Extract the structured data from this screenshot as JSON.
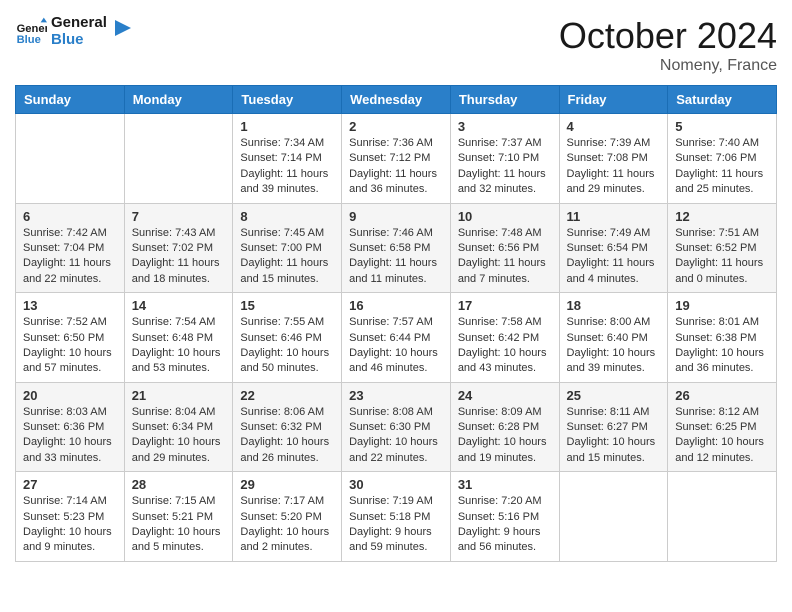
{
  "header": {
    "logo_general": "General",
    "logo_blue": "Blue",
    "month_title": "October 2024",
    "location": "Nomeny, France"
  },
  "days_of_week": [
    "Sunday",
    "Monday",
    "Tuesday",
    "Wednesday",
    "Thursday",
    "Friday",
    "Saturday"
  ],
  "weeks": [
    [
      {
        "day": "",
        "sunrise": "",
        "sunset": "",
        "daylight": ""
      },
      {
        "day": "",
        "sunrise": "",
        "sunset": "",
        "daylight": ""
      },
      {
        "day": "1",
        "sunrise": "Sunrise: 7:34 AM",
        "sunset": "Sunset: 7:14 PM",
        "daylight": "Daylight: 11 hours and 39 minutes."
      },
      {
        "day": "2",
        "sunrise": "Sunrise: 7:36 AM",
        "sunset": "Sunset: 7:12 PM",
        "daylight": "Daylight: 11 hours and 36 minutes."
      },
      {
        "day": "3",
        "sunrise": "Sunrise: 7:37 AM",
        "sunset": "Sunset: 7:10 PM",
        "daylight": "Daylight: 11 hours and 32 minutes."
      },
      {
        "day": "4",
        "sunrise": "Sunrise: 7:39 AM",
        "sunset": "Sunset: 7:08 PM",
        "daylight": "Daylight: 11 hours and 29 minutes."
      },
      {
        "day": "5",
        "sunrise": "Sunrise: 7:40 AM",
        "sunset": "Sunset: 7:06 PM",
        "daylight": "Daylight: 11 hours and 25 minutes."
      }
    ],
    [
      {
        "day": "6",
        "sunrise": "Sunrise: 7:42 AM",
        "sunset": "Sunset: 7:04 PM",
        "daylight": "Daylight: 11 hours and 22 minutes."
      },
      {
        "day": "7",
        "sunrise": "Sunrise: 7:43 AM",
        "sunset": "Sunset: 7:02 PM",
        "daylight": "Daylight: 11 hours and 18 minutes."
      },
      {
        "day": "8",
        "sunrise": "Sunrise: 7:45 AM",
        "sunset": "Sunset: 7:00 PM",
        "daylight": "Daylight: 11 hours and 15 minutes."
      },
      {
        "day": "9",
        "sunrise": "Sunrise: 7:46 AM",
        "sunset": "Sunset: 6:58 PM",
        "daylight": "Daylight: 11 hours and 11 minutes."
      },
      {
        "day": "10",
        "sunrise": "Sunrise: 7:48 AM",
        "sunset": "Sunset: 6:56 PM",
        "daylight": "Daylight: 11 hours and 7 minutes."
      },
      {
        "day": "11",
        "sunrise": "Sunrise: 7:49 AM",
        "sunset": "Sunset: 6:54 PM",
        "daylight": "Daylight: 11 hours and 4 minutes."
      },
      {
        "day": "12",
        "sunrise": "Sunrise: 7:51 AM",
        "sunset": "Sunset: 6:52 PM",
        "daylight": "Daylight: 11 hours and 0 minutes."
      }
    ],
    [
      {
        "day": "13",
        "sunrise": "Sunrise: 7:52 AM",
        "sunset": "Sunset: 6:50 PM",
        "daylight": "Daylight: 10 hours and 57 minutes."
      },
      {
        "day": "14",
        "sunrise": "Sunrise: 7:54 AM",
        "sunset": "Sunset: 6:48 PM",
        "daylight": "Daylight: 10 hours and 53 minutes."
      },
      {
        "day": "15",
        "sunrise": "Sunrise: 7:55 AM",
        "sunset": "Sunset: 6:46 PM",
        "daylight": "Daylight: 10 hours and 50 minutes."
      },
      {
        "day": "16",
        "sunrise": "Sunrise: 7:57 AM",
        "sunset": "Sunset: 6:44 PM",
        "daylight": "Daylight: 10 hours and 46 minutes."
      },
      {
        "day": "17",
        "sunrise": "Sunrise: 7:58 AM",
        "sunset": "Sunset: 6:42 PM",
        "daylight": "Daylight: 10 hours and 43 minutes."
      },
      {
        "day": "18",
        "sunrise": "Sunrise: 8:00 AM",
        "sunset": "Sunset: 6:40 PM",
        "daylight": "Daylight: 10 hours and 39 minutes."
      },
      {
        "day": "19",
        "sunrise": "Sunrise: 8:01 AM",
        "sunset": "Sunset: 6:38 PM",
        "daylight": "Daylight: 10 hours and 36 minutes."
      }
    ],
    [
      {
        "day": "20",
        "sunrise": "Sunrise: 8:03 AM",
        "sunset": "Sunset: 6:36 PM",
        "daylight": "Daylight: 10 hours and 33 minutes."
      },
      {
        "day": "21",
        "sunrise": "Sunrise: 8:04 AM",
        "sunset": "Sunset: 6:34 PM",
        "daylight": "Daylight: 10 hours and 29 minutes."
      },
      {
        "day": "22",
        "sunrise": "Sunrise: 8:06 AM",
        "sunset": "Sunset: 6:32 PM",
        "daylight": "Daylight: 10 hours and 26 minutes."
      },
      {
        "day": "23",
        "sunrise": "Sunrise: 8:08 AM",
        "sunset": "Sunset: 6:30 PM",
        "daylight": "Daylight: 10 hours and 22 minutes."
      },
      {
        "day": "24",
        "sunrise": "Sunrise: 8:09 AM",
        "sunset": "Sunset: 6:28 PM",
        "daylight": "Daylight: 10 hours and 19 minutes."
      },
      {
        "day": "25",
        "sunrise": "Sunrise: 8:11 AM",
        "sunset": "Sunset: 6:27 PM",
        "daylight": "Daylight: 10 hours and 15 minutes."
      },
      {
        "day": "26",
        "sunrise": "Sunrise: 8:12 AM",
        "sunset": "Sunset: 6:25 PM",
        "daylight": "Daylight: 10 hours and 12 minutes."
      }
    ],
    [
      {
        "day": "27",
        "sunrise": "Sunrise: 7:14 AM",
        "sunset": "Sunset: 5:23 PM",
        "daylight": "Daylight: 10 hours and 9 minutes."
      },
      {
        "day": "28",
        "sunrise": "Sunrise: 7:15 AM",
        "sunset": "Sunset: 5:21 PM",
        "daylight": "Daylight: 10 hours and 5 minutes."
      },
      {
        "day": "29",
        "sunrise": "Sunrise: 7:17 AM",
        "sunset": "Sunset: 5:20 PM",
        "daylight": "Daylight: 10 hours and 2 minutes."
      },
      {
        "day": "30",
        "sunrise": "Sunrise: 7:19 AM",
        "sunset": "Sunset: 5:18 PM",
        "daylight": "Daylight: 9 hours and 59 minutes."
      },
      {
        "day": "31",
        "sunrise": "Sunrise: 7:20 AM",
        "sunset": "Sunset: 5:16 PM",
        "daylight": "Daylight: 9 hours and 56 minutes."
      },
      {
        "day": "",
        "sunrise": "",
        "sunset": "",
        "daylight": ""
      },
      {
        "day": "",
        "sunrise": "",
        "sunset": "",
        "daylight": ""
      }
    ]
  ]
}
